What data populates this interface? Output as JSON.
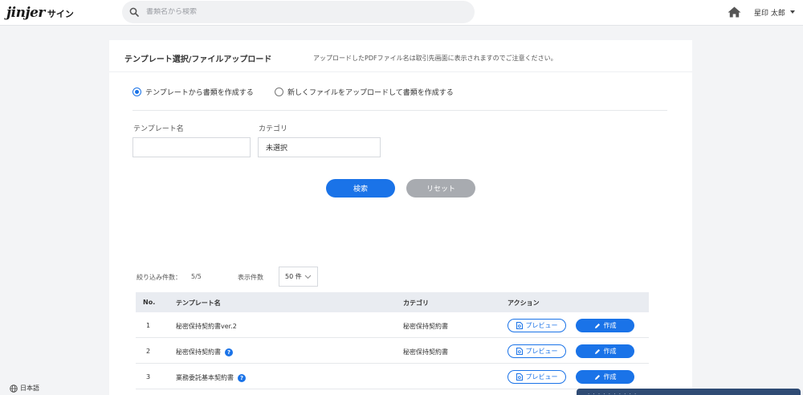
{
  "header": {
    "logo_main": "jinjer",
    "logo_sub": "サイン",
    "search_placeholder": "書類名から検索",
    "user_name": "星印 太郎",
    "home_icon": "home-icon"
  },
  "card": {
    "title": "テンプレート選択/ファイルアップロード",
    "note": "アップロードしたPDFファイル名は取引先画面に表示されますのでご注意ください。",
    "mode_options": [
      {
        "label": "テンプレートから書類を作成する",
        "checked": true
      },
      {
        "label": "新しくファイルをアップロードして書類を作成する",
        "checked": false
      }
    ],
    "filters": {
      "template_name_label": "テンプレート名",
      "template_name_value": "",
      "category_label": "カテゴリ",
      "category_value": "未選択"
    },
    "buttons": {
      "search": "検索",
      "reset": "リセット"
    },
    "result": {
      "count_label": "絞り込み件数：",
      "count_value": "5/5",
      "per_page_label": "表示件数",
      "per_page_value": "50 件"
    },
    "table": {
      "headers": {
        "no": "No.",
        "name": "テンプレート名",
        "category": "カテゴリ",
        "action": "アクション"
      },
      "preview_label": "プレビュー",
      "create_label": "作成",
      "rows": [
        {
          "no": "1",
          "name": "秘密保持契約書ver.2",
          "category": "秘密保持契約書",
          "help": false
        },
        {
          "no": "2",
          "name": "秘密保持契約書",
          "category": "秘密保持契約書",
          "help": true
        },
        {
          "no": "3",
          "name": "業務委託基本契約書",
          "category": "",
          "help": true
        }
      ]
    }
  },
  "footer": {
    "language": "日本語",
    "toast_text": "· · · ·  · ·  · · · ·"
  },
  "colors": {
    "accent": "#1a73e8",
    "reset_gray": "#a8abb0",
    "toast_bg": "#2f4b74"
  }
}
